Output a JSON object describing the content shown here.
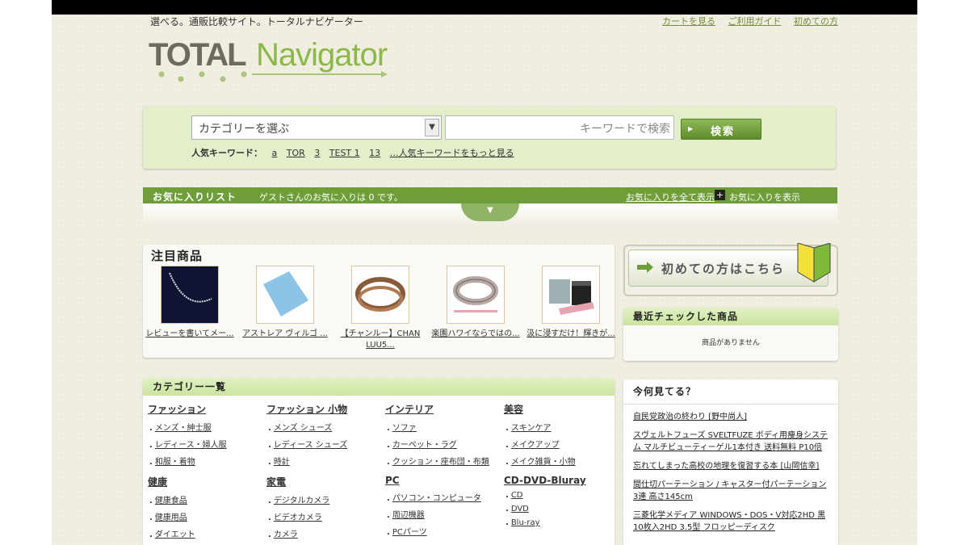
{
  "header": {
    "tagline": "選べる。通販比較サイト。トータルナビゲーター",
    "links": [
      "カートを見る",
      "ご利用ガイド",
      "初めての方"
    ],
    "logo_total": "TOTAL",
    "logo_navigator": "Navigator"
  },
  "search": {
    "category_placeholder": "カテゴリーを選ぶ",
    "keyword_placeholder": "キーワードで検索",
    "button_label": "検索",
    "popular_label": "人気キーワード：",
    "popular_keywords": [
      "a",
      "TOR",
      "3",
      "TEST 1",
      "13"
    ],
    "more_link": "…人気キーワードをもっと見る"
  },
  "favorites": {
    "title": "お気に入りリスト",
    "message": "ゲストさんのお気に入りは 0 です。",
    "show_all": "お気に入りを全て表示",
    "show": "お気に入りを表示"
  },
  "featured": {
    "title": "注目商品",
    "items": [
      {
        "caption": "レビューを書いてメー..."
      },
      {
        "caption": "アストレア ヴィルゴ ..."
      },
      {
        "caption": "【チャンルー】CHAN LUU5..."
      },
      {
        "caption": "楽園ハワイならではの..."
      },
      {
        "caption": "汲に浸すだけ！輝きが..."
      }
    ]
  },
  "first_time_button": "初めての方はこちら",
  "recent": {
    "title": "最近チェックした商品",
    "empty": "商品がありません"
  },
  "categories": {
    "title": "カテゴリー一覧",
    "groups": [
      {
        "name": "ファッション",
        "items": [
          "メンズ・紳士服",
          "レディース・婦人服",
          "和服・着物"
        ]
      },
      {
        "name": "ファッション 小物",
        "items": [
          "メンズ シューズ",
          "レディース シューズ",
          "時計"
        ]
      },
      {
        "name": "インテリア",
        "items": [
          "ソファ",
          "カーペット・ラグ",
          "クッション・座布団・布類"
        ]
      },
      {
        "name": "美容",
        "items": [
          "スキンケア",
          "メイクアップ",
          "メイク雑貨・小物"
        ]
      },
      {
        "name": "健康",
        "items": [
          "健康食品",
          "健康用品",
          "ダイエット"
        ]
      },
      {
        "name": "家電",
        "items": [
          "デジタルカメラ",
          "ビデオカメラ",
          "カメラ"
        ]
      },
      {
        "name": "PC",
        "items": [
          "パソコン・コンピュータ",
          "周辺機器",
          "PCパーツ"
        ]
      },
      {
        "name": "CD-DVD-Bluray",
        "items": [
          "CD",
          "DVD",
          "Blu-ray"
        ]
      }
    ]
  },
  "watching": {
    "title": "今何見てる？",
    "items": [
      "自民党政治の終わり [野中尚人]",
      "スヴェルトフューズ SVELTFUZE ボディ用痩身システム マルチビューティーゲル1本付き 送料無料 P10倍",
      "忘れてしまった高校の地理を復習する本 [山岡信幸]",
      "間仕切パーテーション / キャスター付パーテーション3連 高さ145cm",
      "三菱化学メディア WINDOWS・DOS・V対応2HD 黒 10枚入2HD 3.5型 フロッピーディスク"
    ]
  },
  "colors": {
    "accent_green": "#6f9d3a",
    "light_green": "#e3efcb",
    "background": "#efece0"
  }
}
